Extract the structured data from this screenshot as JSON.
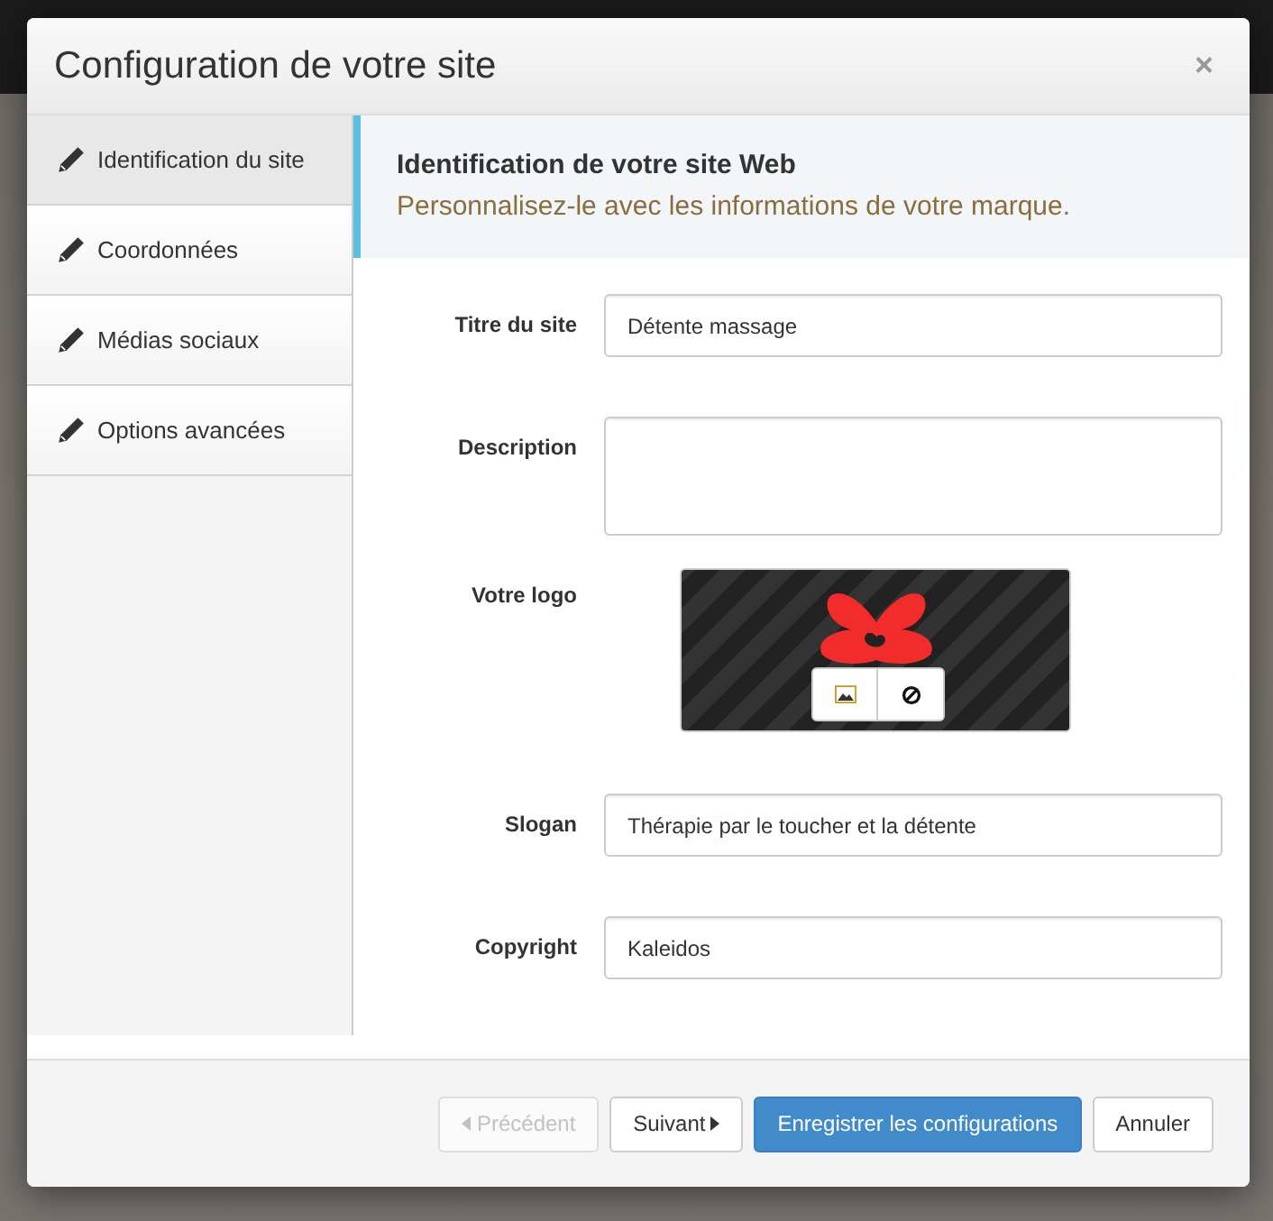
{
  "dialog": {
    "title": "Configuration de votre site",
    "close": "×"
  },
  "sidebar": {
    "items": [
      {
        "label": "Identification du site",
        "selected": true
      },
      {
        "label": "Coordonnées",
        "selected": false
      },
      {
        "label": "Médias sociaux",
        "selected": false
      },
      {
        "label": "Options avancées",
        "selected": false
      }
    ]
  },
  "panel": {
    "heading": "Identification de votre site Web",
    "subheading": "Personnalisez-le avec les informations de votre marque."
  },
  "fields": [
    {
      "kind": "text",
      "label": "Titre du site",
      "value": "Détente massage"
    },
    {
      "kind": "textarea",
      "label": "Description"
    },
    {
      "kind": "logo",
      "label": "Votre logo"
    },
    {
      "kind": "text",
      "label": "Slogan",
      "value": "Thérapie par le toucher et la détente"
    },
    {
      "kind": "text",
      "label": "Copyright",
      "value": "Kaleidos"
    }
  ],
  "buttons": [
    {
      "kind": "prev",
      "label": "Précédent",
      "disabled": true
    },
    {
      "kind": "next",
      "label": "Suivant",
      "disabled": false
    },
    {
      "kind": "primary",
      "label": "Enregistrer les configurations",
      "disabled": false
    },
    {
      "kind": "default",
      "label": "Annuler",
      "disabled": false
    }
  ]
}
